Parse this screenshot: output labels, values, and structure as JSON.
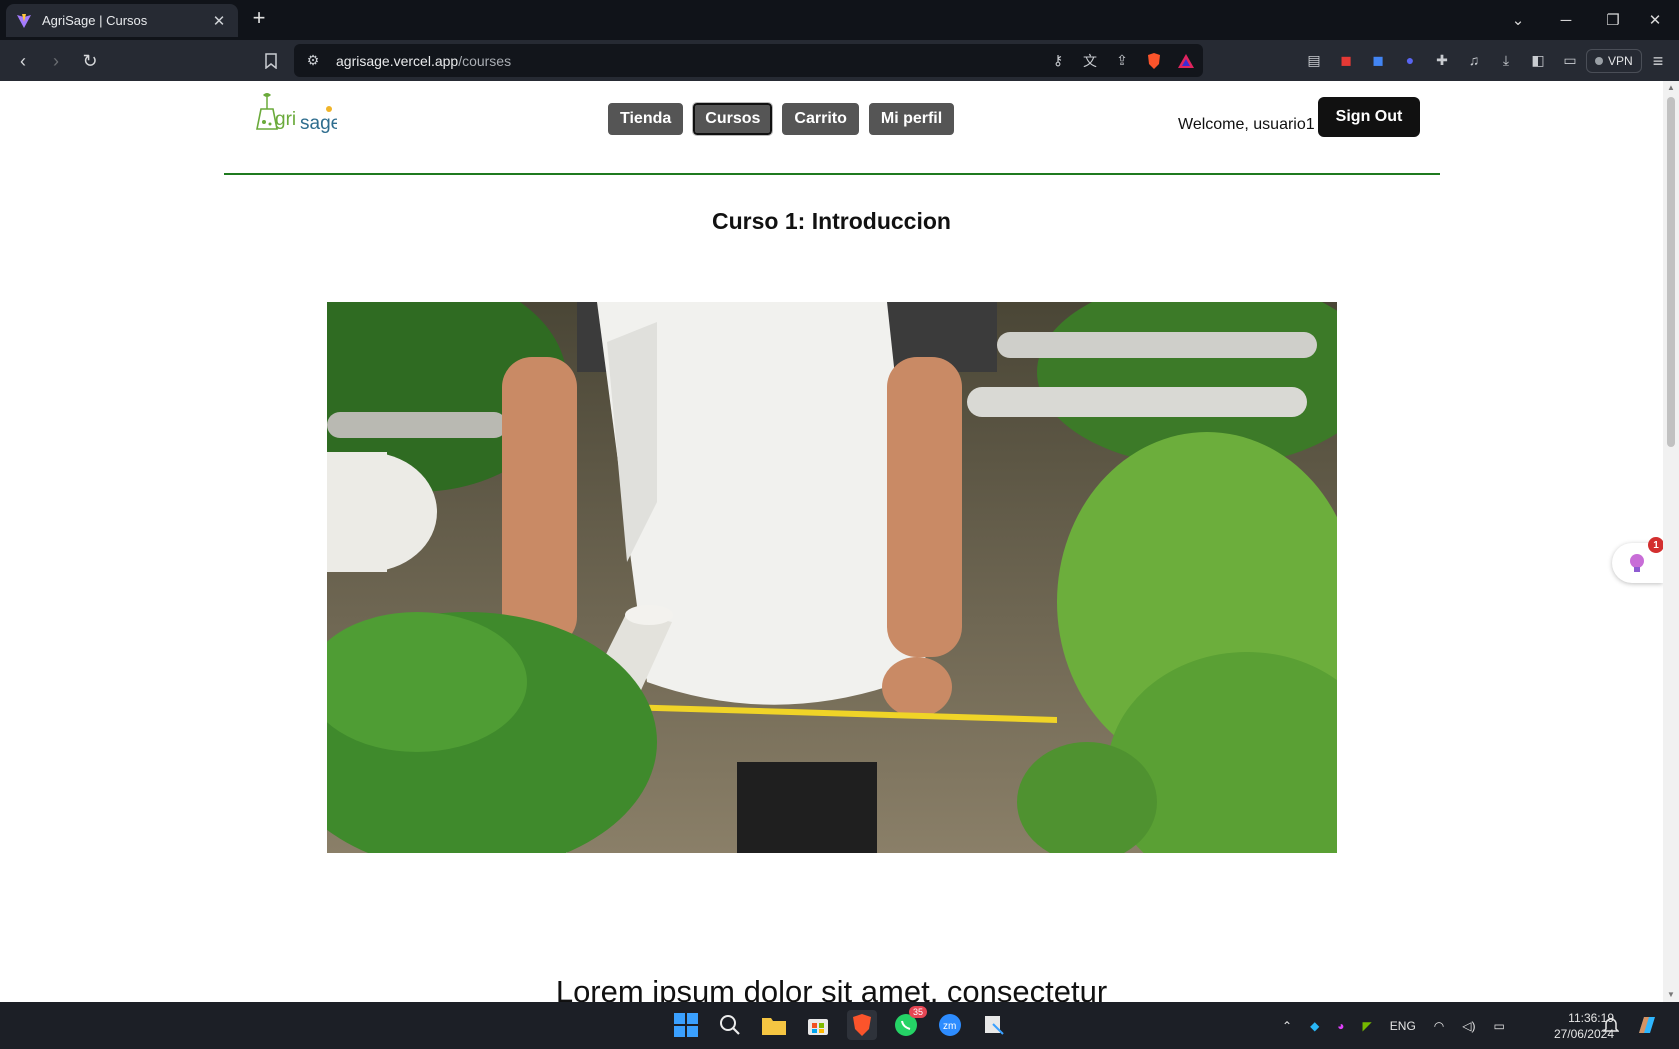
{
  "browser": {
    "tab_title": "AgriSage | Cursos",
    "tab_close": "✕",
    "new_tab": "+",
    "url_host": "agrisage.vercel.app",
    "url_path": "/courses",
    "vpn_label": "VPN",
    "window_controls": [
      "minimize",
      "restore",
      "close"
    ]
  },
  "header": {
    "nav": [
      "Tienda",
      "Cursos",
      "Carrito",
      "Mi perfil"
    ],
    "active_nav": "Cursos",
    "welcome": "Welcome, usuario1",
    "sign_out": "Sign Out",
    "accent_color": "#1f7a1f"
  },
  "main": {
    "course_title": "Curso 1: Introduccion",
    "video_subject": "hydroponic-greenhouse-measuring-tape",
    "body_text": "Lorem ipsum dolor sit amet, consectetur"
  },
  "floating_widget": {
    "badge": "1"
  },
  "taskbar": {
    "whatsapp_badge": "35",
    "lang": "ENG",
    "time": "11:36:19",
    "date": "27/06/2024"
  }
}
